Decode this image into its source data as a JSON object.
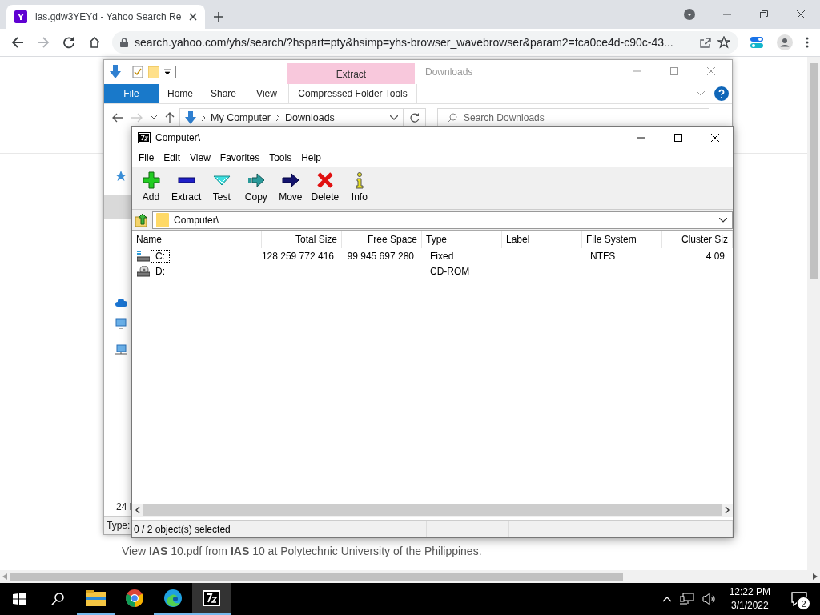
{
  "browser": {
    "tab": {
      "title": "ias.gdw3YEYd - Yahoo Search Re"
    },
    "url": "search.yahoo.com/yhs/search/?hspart=pty&hsimp=yhs-browser_wavebrowser&param2=fca0ce4d-c90c-43...",
    "page_text": "View **IAS** 10.pdf from **IAS** 10 at Polytechnic University of the Philippines."
  },
  "explorer": {
    "title": "Downloads",
    "context_header": "Extract",
    "ribbon_tabs": [
      {
        "label": "File",
        "kind": "file"
      },
      {
        "label": "Home",
        "kind": "tab"
      },
      {
        "label": "Share",
        "kind": "tab"
      },
      {
        "label": "View",
        "kind": "tab"
      },
      {
        "label": "Compressed Folder Tools",
        "kind": "context"
      }
    ],
    "breadcrumb": [
      "My Computer",
      "Downloads"
    ],
    "search": {
      "placeholder": "Search Downloads"
    },
    "item_count": "24 i",
    "details": "Type:"
  },
  "sevenzip": {
    "title": "Computer\\",
    "menu": [
      "File",
      "Edit",
      "View",
      "Favorites",
      "Tools",
      "Help"
    ],
    "toolbar": [
      {
        "label": "Add",
        "kind": "add"
      },
      {
        "label": "Extract",
        "kind": "extract"
      },
      {
        "label": "Test",
        "kind": "test"
      },
      {
        "label": "Copy",
        "kind": "copy"
      },
      {
        "label": "Move",
        "kind": "move"
      },
      {
        "label": "Delete",
        "kind": "delete"
      },
      {
        "label": "Info",
        "kind": "info"
      }
    ],
    "path": "Computer\\",
    "columns": [
      {
        "label": "Name",
        "kind": "text"
      },
      {
        "label": "Total Size",
        "kind": "number"
      },
      {
        "label": "Free Space",
        "kind": "number"
      },
      {
        "label": "Type",
        "kind": "text"
      },
      {
        "label": "Label",
        "kind": "text"
      },
      {
        "label": "File System",
        "kind": "text"
      },
      {
        "label": "Cluster Siz",
        "kind": "number"
      }
    ],
    "rows": [
      {
        "kind": "hdd",
        "focused": true,
        "cells": [
          "C:",
          "128 259 772 416",
          "99 945 697 280",
          "Fixed",
          null,
          "NTFS",
          "4 09"
        ]
      },
      {
        "kind": "cdrom",
        "focused": false,
        "cells": [
          "D:",
          null,
          null,
          "CD-ROM",
          null,
          null,
          null
        ]
      }
    ],
    "status": "0 / 2 object(s) selected"
  },
  "taskbar": {
    "apps": [
      {
        "kind": "explorer",
        "running": true,
        "active": false
      },
      {
        "kind": "chrome",
        "running": false,
        "active": false
      },
      {
        "kind": "edge",
        "running": true,
        "active": false
      },
      {
        "kind": "sevenzip",
        "running": true,
        "active": true
      }
    ],
    "time": "12:22 PM",
    "date": "3/1/2022",
    "notifications": "2"
  }
}
